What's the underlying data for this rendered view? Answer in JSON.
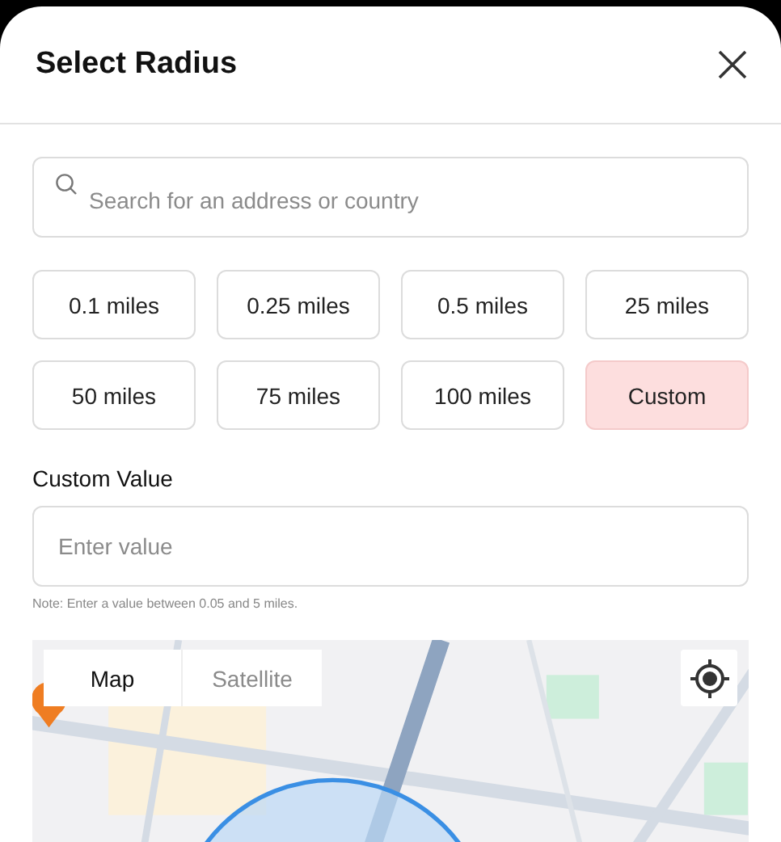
{
  "title": "Select Radius",
  "search": {
    "placeholder": "Search for an address or country"
  },
  "radius_options": [
    {
      "label": "0.1 miles",
      "selected": false
    },
    {
      "label": "0.25 miles",
      "selected": false
    },
    {
      "label": "0.5 miles",
      "selected": false
    },
    {
      "label": "25 miles",
      "selected": false
    },
    {
      "label": "50 miles",
      "selected": false
    },
    {
      "label": "75 miles",
      "selected": false
    },
    {
      "label": "100 miles",
      "selected": false
    },
    {
      "label": "Custom",
      "selected": true
    }
  ],
  "custom_value": {
    "label": "Custom Value",
    "placeholder": "Enter value",
    "note": "Note: Enter a value between 0.05 and 5 miles."
  },
  "map": {
    "kind": "picture",
    "map_types": [
      {
        "label": "Map",
        "selected": true
      },
      {
        "label": "Satellite",
        "selected": false
      }
    ]
  }
}
